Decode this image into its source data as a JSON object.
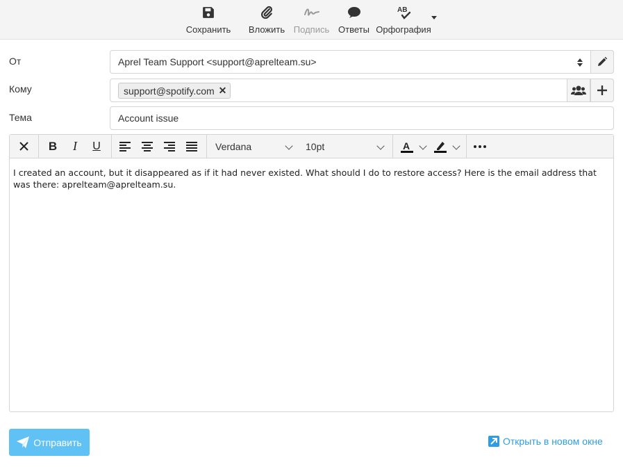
{
  "toolbar": {
    "save_label": "Сохранить",
    "attach_label": "Вложить",
    "signature_label": "Подпись",
    "responses_label": "Ответы",
    "spellcheck_label": "Орфография",
    "spellcheck_icon_text": "AB"
  },
  "form": {
    "from_label": "От",
    "from_value": "Aprel Team Support <support@aprelteam.su>",
    "to_label": "Кому",
    "to_recipients": [
      "support@spotify.com"
    ],
    "subject_label": "Тема",
    "subject_value": "Account issue"
  },
  "editor": {
    "font_family": "Verdana",
    "font_size": "10pt",
    "body": "I created an account, but it disappeared as if it had never existed. What should I do to restore access? Here is the email address that was there: aprelteam@aprelteam.su."
  },
  "footer": {
    "send_label": "Отправить",
    "open_new_window_label": "Открыть в новом окне"
  },
  "colors": {
    "accent": "#5fc1f4",
    "link": "#2e9de6",
    "toolbar_bg": "#f4f4f4"
  },
  "icons": [
    "save-icon",
    "paperclip-icon",
    "signature-icon",
    "chat-bubble-icon",
    "spellcheck-icon",
    "pencil-icon",
    "users-icon",
    "plus-icon",
    "close-icon",
    "bold-icon",
    "italic-icon",
    "underline-icon",
    "align-left-icon",
    "align-center-icon",
    "align-right-icon",
    "align-justify-icon",
    "text-color-icon",
    "highlighter-icon",
    "more-icon",
    "paper-plane-icon",
    "external-window-icon"
  ]
}
